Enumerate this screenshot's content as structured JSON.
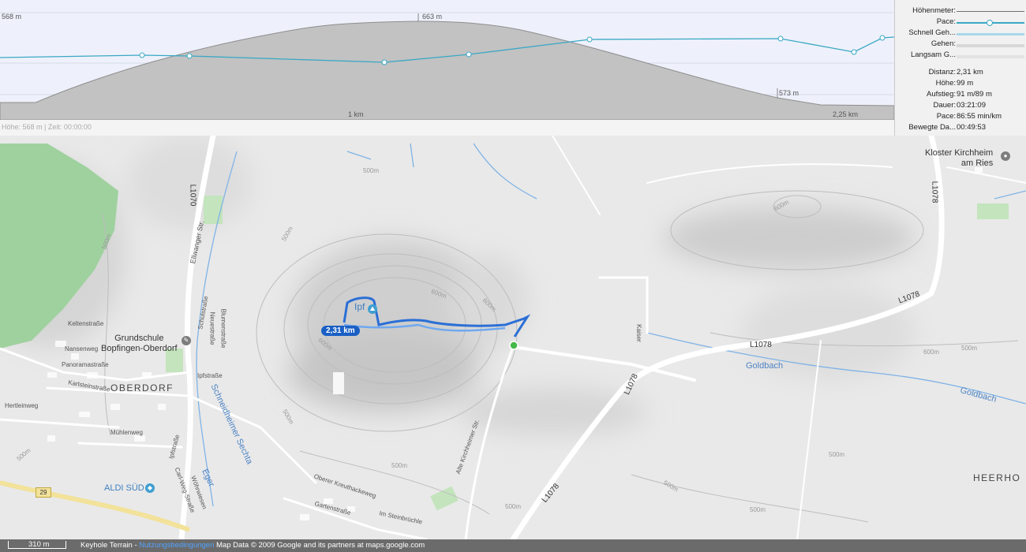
{
  "profile": {
    "start_elev_label": "568 m",
    "peak_label": "663 m",
    "low_label": "573 m",
    "tick_1": "1 km",
    "tick_2": "2,25 km",
    "status": "Höhe: 568 m | Zeit: 00:00:00",
    "colors": {
      "background": "#eef1fb",
      "terrain": "#c2c2c2",
      "pace_line": "#3aa8c4"
    }
  },
  "legend": [
    {
      "label": "Höhenmeter:",
      "style": "elevation"
    },
    {
      "label": "Pace:",
      "style": "pace"
    },
    {
      "label": "Schnell Geh...",
      "style": "fast"
    },
    {
      "label": "Gehen:",
      "style": "walk"
    },
    {
      "label": "Langsam G...",
      "style": "slow"
    }
  ],
  "stats": [
    {
      "label": "Distanz:",
      "value": "2,31 km"
    },
    {
      "label": "Höhe:",
      "value": "99 m"
    },
    {
      "label": "Aufstieg:",
      "value": "91 m/89 m"
    },
    {
      "label": "Dauer:",
      "value": "03:21:09"
    },
    {
      "label": "Pace:",
      "value": "86:55 min/km"
    },
    {
      "label": "Bewegte Da...",
      "value": "00:49:53"
    }
  ],
  "map": {
    "route_badge": "2,31 km",
    "poi_ipf": "Ipf",
    "poi_kloster": "Kloster Kirchheim\nam Ries",
    "poi_school": "Grundschule\nBopfingen-Oberdorf",
    "poi_aldi": "ALDI SÜD",
    "town_oberdorf": "OBERDORF",
    "town_heerhof": "HEERHO",
    "road_l1078_a": "L1078",
    "road_l1078_b": "L1078",
    "road_l1078_c": "L1078",
    "road_l1078_d": "L1078",
    "road_l1078_e": "L1078",
    "road_l1070": "L1070",
    "road_29": "29",
    "street_ellwanger": "Ellwanger Str.",
    "street_schulstrasse": "Schulstraße",
    "street_neuestrasse": "Neuestraße",
    "street_blumenstrasse": "Blumenstraße",
    "street_keltenstrasse": "Keltenstraße",
    "street_nansenweg": "Nansenweg",
    "street_panoramastrasse": "Panoramastraße",
    "street_karlsteinstrasse": "Karlsteinstraße",
    "street_hertleinweg": "Hertleinweg",
    "street_muehlenweg": "Mühlenweg",
    "street_ipfstrasse": "Ipfstraße",
    "street_ipfstrasse2": "Ipfstraße",
    "street_carlweg": "Carl-Weg-Straße",
    "street_woehrwiesen": "Wöhrwiesen",
    "street_gartenstrasse": "Gartenstraße",
    "street_oberer": "Oberer Kreuthackeweg",
    "street_steinbruechle": "Im Steinbrüchle",
    "street_altekirchheimer": "Alte Kirchheimer Str.",
    "street_kaiser": "Kaiser",
    "water_sechta": "Schneidheimer Sechta",
    "water_eger": "Eger",
    "water_goldbach1": "Goldbach",
    "water_goldbach2": "Goldbach",
    "c600_1": "600m",
    "c600_2": "600m",
    "c600_3": "600m",
    "c600_4": "600m",
    "c500_1": "500m",
    "c500_2": "500m",
    "c500_3": "500m",
    "c500_4": "500m",
    "c500_5": "500m",
    "c500_6": "500m",
    "c500_7": "500m",
    "c500_8": "500m",
    "c500_9": "500m",
    "c600_5": "600m",
    "c500_10": "500m",
    "c500_11": "500m"
  },
  "footer": {
    "scale": "310 m",
    "provider": "Keyhole Terrain - ",
    "terms": "Nutzungsbedingungen",
    "copyright": " Map Data © 2009 Google and its partners at maps.google.com"
  }
}
